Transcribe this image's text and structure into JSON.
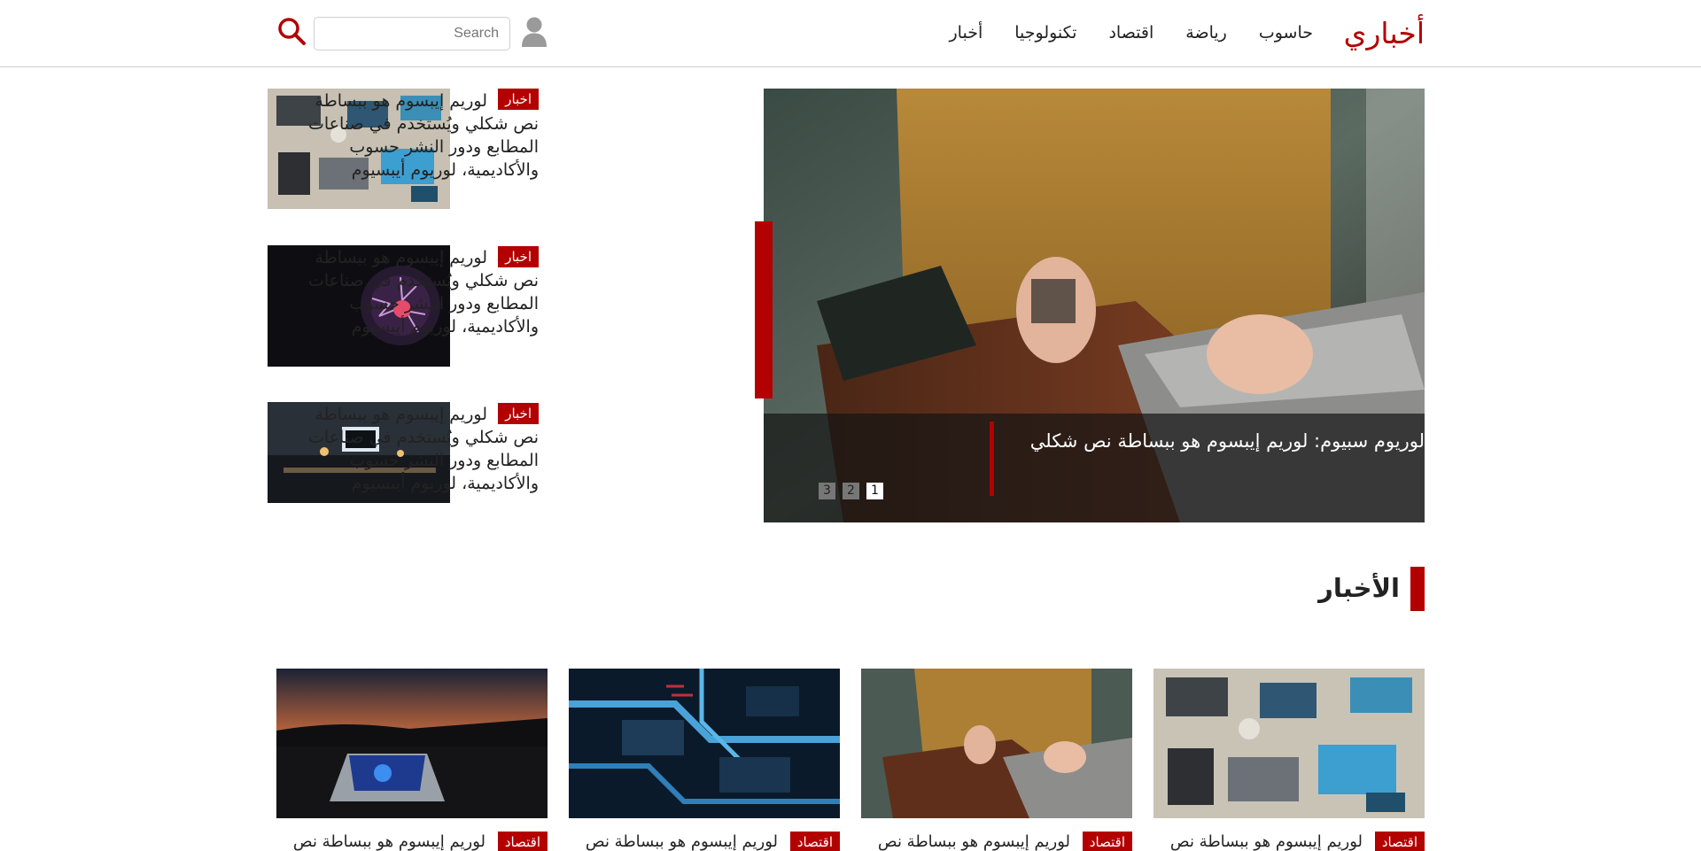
{
  "header": {
    "logo": "أخباري",
    "nav": [
      "أخبار",
      "تكنولوجيا",
      "اقتصاد",
      "رياضة",
      "حاسوب"
    ],
    "search_placeholder": "Search"
  },
  "hero": {
    "title": "لوريوم سبيوم: لوريم إيبسوم هو ببساطة نص شكلي",
    "pages": [
      "1",
      "2",
      "3"
    ],
    "active_page": "1"
  },
  "side_items": [
    {
      "badge": "اخبار",
      "text_line1": "لوريم إيبسوم هو ببساطة",
      "text_rest": "نص شكلي ويُستخدم في صناعات المطابع ودور النشر حسوب والأكاديمية، لوريوم أيبسيوم",
      "image": "laptops-desk"
    },
    {
      "badge": "اخبار",
      "text_line1": "لوريم إيبسوم هو ببساطة",
      "text_rest": "نص شكلي ويُستخدم في صناعات المطابع ودور النشر حسوب والأكاديمية، لوريوم أيبسيوم",
      "image": "plasma-ball"
    },
    {
      "badge": "اخبار",
      "text_line1": "لوريم إيبسوم هو ببساطة",
      "text_rest": "نص شكلي ويُستخدم في صناعات المطابع ودور النشر حسوب والأكاديمية، لوريوم أيبسيوم",
      "image": "monitor-desk"
    }
  ],
  "news_section": {
    "title": "الأخبار",
    "cards": [
      {
        "badge": "اقتصاد",
        "title": "لوريم إيبسوم هو ببساطة نص",
        "image": "laptops-desk"
      },
      {
        "badge": "اقتصاد",
        "title": "لوريم إيبسوم هو ببساطة نص",
        "image": "woman-laptop"
      },
      {
        "badge": "اقتصاد",
        "title": "لوريم إيبسوم هو ببساطة نص",
        "image": "circuit-board"
      },
      {
        "badge": "اقتصاد",
        "title": "لوريم إيبسوم هو ببساطة نص",
        "image": "laptop-sunset"
      }
    ]
  },
  "colors": {
    "accent": "#b30000",
    "text": "#222222",
    "border": "#cfcfcf"
  },
  "icons": {
    "search": "search-icon",
    "user": "user-icon"
  }
}
